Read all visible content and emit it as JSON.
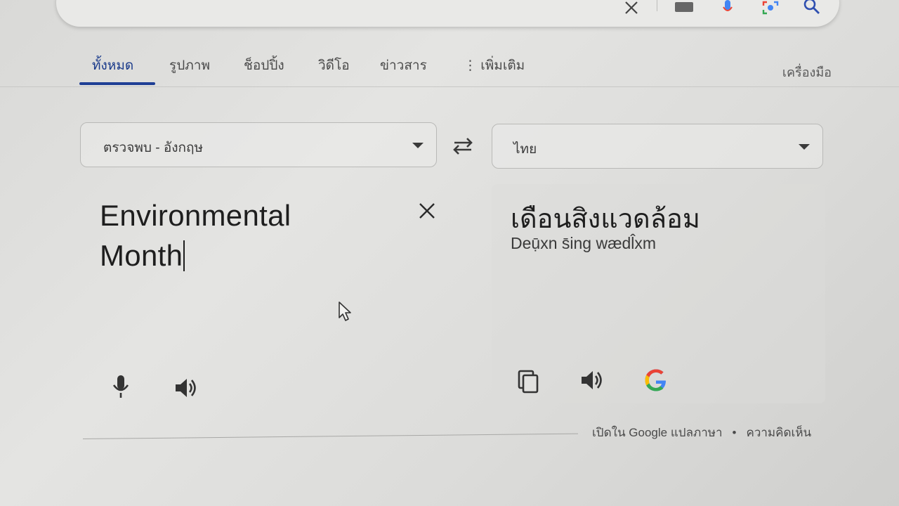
{
  "tabs": {
    "items": [
      {
        "label": "ทั้งหมด"
      },
      {
        "label": "รูปภาพ"
      },
      {
        "label": "ช็อปปิ้ง"
      },
      {
        "label": "วิดีโอ"
      },
      {
        "label": "ข่าวสาร"
      },
      {
        "label": "⋮ เพิ่มเติม"
      }
    ],
    "tools_label": "เครื่องมือ"
  },
  "translator": {
    "source_language": "ตรวจพบ - อังกฤษ",
    "target_language": "ไทย",
    "source_text_line1": "Environmental",
    "source_text_line2": "Month",
    "translated_text": "เดือนสิงแวดล้อม",
    "transliteration": "Deụ̄xn s̄ing wædl̂xm"
  },
  "footer": {
    "open_in_translate": "เปิดใน Google แปลภาษา",
    "separator": "•",
    "feedback": "ความคิดเห็น"
  }
}
